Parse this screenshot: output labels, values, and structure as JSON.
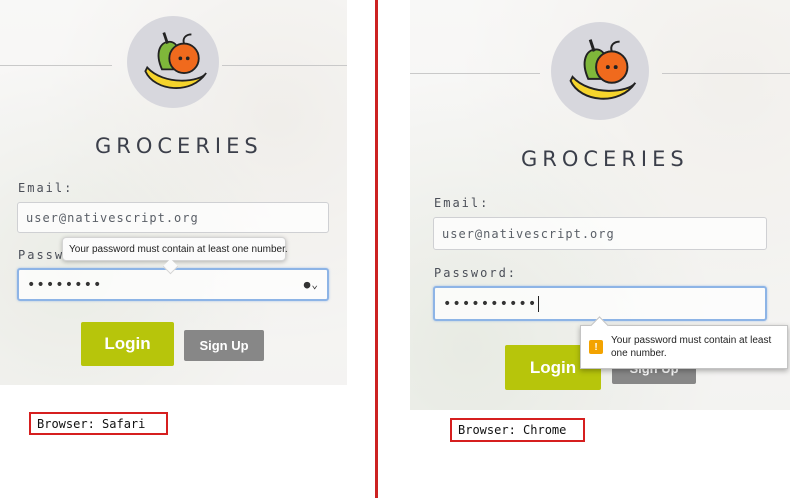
{
  "app": {
    "title": "GROCERIES",
    "email_label": "Email:",
    "email_value": "user@nativescript.org",
    "password_label": "Password:",
    "password_mask": "••••••••",
    "login_label": "Login",
    "signup_label": "Sign Up"
  },
  "safari": {
    "caption": "Browser: Safari",
    "tooltip": "Your password must contain at least one number."
  },
  "chrome": {
    "caption": "Browser: Chrome",
    "password_mask": "••••••••••",
    "tooltip": "Your password must contain at least one number."
  },
  "icons": [
    "fruit-logo-icon",
    "key-icon",
    "warning-icon"
  ],
  "colors": {
    "login": "#b7c50b",
    "signup": "#878787",
    "divider": "#cc2222",
    "warning": "#f3a300",
    "focus": "#8db4e6"
  }
}
